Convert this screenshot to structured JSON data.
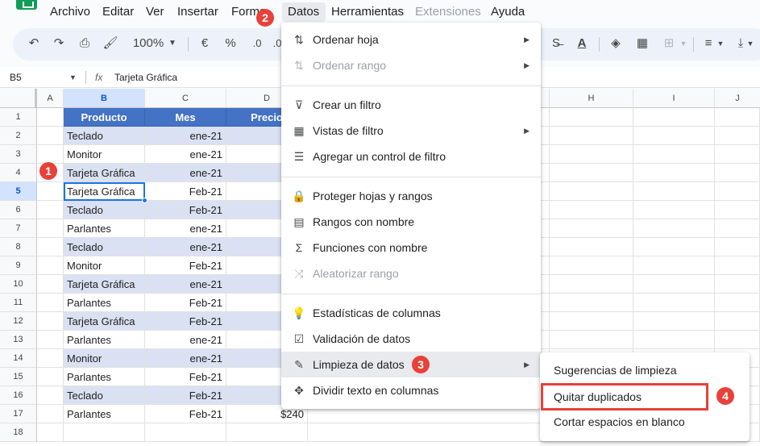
{
  "menubar": {
    "items": [
      "Archivo",
      "Editar",
      "Ver",
      "Insertar",
      "Forma",
      "Datos",
      "Herramientas",
      "Extensiones",
      "Ayuda"
    ]
  },
  "toolbar": {
    "zoom": "100%",
    "currency": "€",
    "percent": "%",
    "decimal_decrease": ".0",
    "decimal_increase": ".0"
  },
  "formula_bar": {
    "name_box": "B5",
    "fx": "fx",
    "content": "Tarjeta Gráfica"
  },
  "grid": {
    "columns": [
      "A",
      "B",
      "C",
      "D",
      "H",
      "I",
      "J"
    ],
    "rows": [
      "1",
      "2",
      "3",
      "4",
      "5",
      "6",
      "7",
      "8",
      "9",
      "10",
      "11",
      "12",
      "13",
      "14",
      "15",
      "16",
      "17",
      "18"
    ],
    "header": {
      "product": "Producto",
      "month": "Mes",
      "price": "Precio"
    },
    "data": [
      {
        "product": "Teclado",
        "month": "ene-21",
        "price": "$"
      },
      {
        "product": "Monitor",
        "month": "ene-21",
        "price": ""
      },
      {
        "product": "Tarjeta Gráfica",
        "month": "ene-21",
        "price": ""
      },
      {
        "product": "Tarjeta Gráfica",
        "month": "Feb-21",
        "price": ""
      },
      {
        "product": "Teclado",
        "month": "Feb-21",
        "price": ""
      },
      {
        "product": "Parlantes",
        "month": "ene-21",
        "price": ""
      },
      {
        "product": "Teclado",
        "month": "ene-21",
        "price": ""
      },
      {
        "product": "Monitor",
        "month": "Feb-21",
        "price": ""
      },
      {
        "product": "Tarjeta Gráfica",
        "month": "ene-21",
        "price": "$"
      },
      {
        "product": "Parlantes",
        "month": "Feb-21",
        "price": ""
      },
      {
        "product": "Tarjeta Gráfica",
        "month": "Feb-21",
        "price": "$"
      },
      {
        "product": "Parlantes",
        "month": "ene-21",
        "price": "$"
      },
      {
        "product": "Monitor",
        "month": "ene-21",
        "price": ""
      },
      {
        "product": "Parlantes",
        "month": "Feb-21",
        "price": ""
      },
      {
        "product": "Teclado",
        "month": "Feb-21",
        "price": ""
      },
      {
        "product": "Parlantes",
        "month": "Feb-21",
        "price": "$240"
      }
    ]
  },
  "datos_menu": {
    "items": [
      {
        "label": "Ordenar hoja",
        "icon": "sort-icon",
        "glyph": "⇅",
        "submenu": true,
        "disabled": false
      },
      {
        "label": "Ordenar rango",
        "icon": "sort-range-icon",
        "glyph": "⇅",
        "submenu": true,
        "disabled": true
      },
      {
        "label": "Crear un filtro",
        "icon": "filter-icon",
        "glyph": "⊽",
        "submenu": false,
        "disabled": false
      },
      {
        "label": "Vistas de filtro",
        "icon": "filter-views-icon",
        "glyph": "▦",
        "submenu": true,
        "disabled": false
      },
      {
        "label": "Agregar un control de filtro",
        "icon": "filter-control-icon",
        "glyph": "☰",
        "submenu": false,
        "disabled": false
      },
      {
        "label": "Proteger hojas y rangos",
        "icon": "lock-icon",
        "glyph": "🔒",
        "submenu": false,
        "disabled": false
      },
      {
        "label": "Rangos con nombre",
        "icon": "named-ranges-icon",
        "glyph": "▤",
        "submenu": false,
        "disabled": false
      },
      {
        "label": "Funciones con nombre",
        "icon": "sigma-icon",
        "glyph": "Σ",
        "submenu": false,
        "disabled": false
      },
      {
        "label": "Aleatorizar rango",
        "icon": "shuffle-icon",
        "glyph": "⤨",
        "submenu": false,
        "disabled": true
      },
      {
        "label": "Estadísticas de columnas",
        "icon": "bulb-icon",
        "glyph": "💡",
        "submenu": false,
        "disabled": false
      },
      {
        "label": "Validación de datos",
        "icon": "validation-icon",
        "glyph": "☑",
        "submenu": false,
        "disabled": false
      },
      {
        "label": "Limpieza de datos",
        "icon": "magic-wand-icon",
        "glyph": "✎",
        "submenu": true,
        "disabled": false
      },
      {
        "label": "Dividir texto en columnas",
        "icon": "split-icon",
        "glyph": "✥",
        "submenu": false,
        "disabled": false
      }
    ]
  },
  "cleanup_submenu": {
    "items": [
      "Sugerencias de limpieza",
      "Quitar duplicados",
      "Cortar espacios en blanco"
    ]
  },
  "step_badges": [
    "1",
    "2",
    "3",
    "4"
  ],
  "colors": {
    "header_blue": "#4472c4",
    "band": "#d9e1f2",
    "badge_red": "#e8413a",
    "highlight_border": "#e8413a"
  }
}
